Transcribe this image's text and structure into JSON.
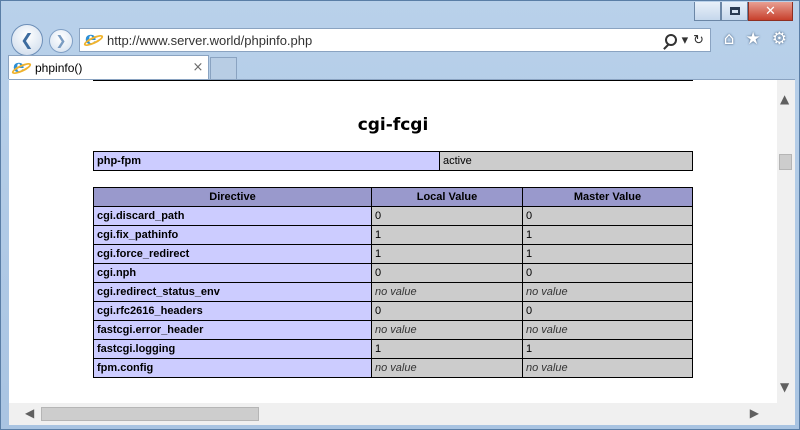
{
  "browser": {
    "url": "http://www.server.world/phpinfo.php",
    "tab_title": "phpinfo()",
    "tab_close": "×",
    "back_glyph": "❮",
    "forward_glyph": "❯",
    "icons": {
      "back": "back-arrow-icon",
      "forward": "forward-arrow-icon",
      "search": "search-icon",
      "dropdown": "chevron-down-icon",
      "refresh": "refresh-icon",
      "home": "home-icon",
      "favorites": "star-icon",
      "settings": "gear-icon"
    },
    "address_dropdown": "▾",
    "address_refresh": "↻",
    "toolbar_home": "⌂",
    "toolbar_star": "★",
    "toolbar_gear": "⚙"
  },
  "window": {
    "close_glyph": "✕"
  },
  "content": {
    "module_title": "cgi-fcgi",
    "status_table": {
      "key": "php-fpm",
      "value": "active"
    },
    "directives": {
      "headers": [
        "Directive",
        "Local Value",
        "Master Value"
      ],
      "rows": [
        {
          "name": "cgi.discard_path",
          "local": "0",
          "master": "0",
          "nv": false
        },
        {
          "name": "cgi.fix_pathinfo",
          "local": "1",
          "master": "1",
          "nv": false
        },
        {
          "name": "cgi.force_redirect",
          "local": "1",
          "master": "1",
          "nv": false
        },
        {
          "name": "cgi.nph",
          "local": "0",
          "master": "0",
          "nv": false
        },
        {
          "name": "cgi.redirect_status_env",
          "local": "no value",
          "master": "no value",
          "nv": true
        },
        {
          "name": "cgi.rfc2616_headers",
          "local": "0",
          "master": "0",
          "nv": false
        },
        {
          "name": "fastcgi.error_header",
          "local": "no value",
          "master": "no value",
          "nv": true
        },
        {
          "name": "fastcgi.logging",
          "local": "1",
          "master": "1",
          "nv": false
        },
        {
          "name": "fpm.config",
          "local": "no value",
          "master": "no value",
          "nv": true
        }
      ]
    }
  },
  "scroll": {
    "up": "▲",
    "down": "▼",
    "left": "◀",
    "right": "▶"
  }
}
